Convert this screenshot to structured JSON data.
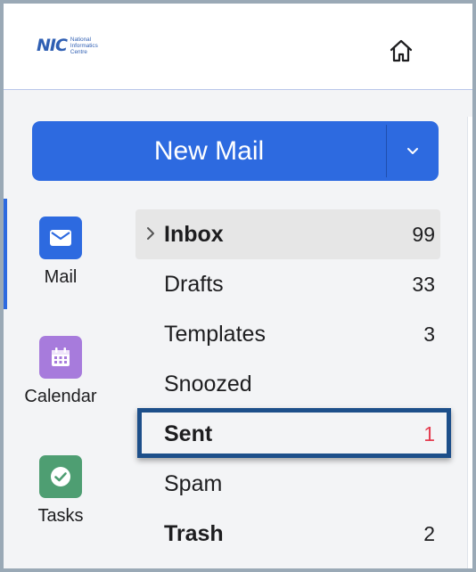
{
  "header": {
    "logo_mark": "NIC",
    "logo_line1": "National",
    "logo_line2": "Informatics",
    "logo_line3": "Centre",
    "home_icon": "home-icon"
  },
  "new_mail": {
    "label": "New Mail",
    "dropdown_icon": "chevron-down-icon",
    "color": "#2d6ae0"
  },
  "apps": [
    {
      "label": "Mail",
      "icon": "mail-icon",
      "color": "#2d6ae0"
    },
    {
      "label": "Calendar",
      "icon": "calendar-icon",
      "color": "#a77bdc"
    },
    {
      "label": "Tasks",
      "icon": "check-icon",
      "color": "#4e9e72"
    }
  ],
  "folders": [
    {
      "name": "Inbox",
      "count": "99",
      "bold": true,
      "active": true
    },
    {
      "name": "Drafts",
      "count": "33",
      "bold": false
    },
    {
      "name": "Templates",
      "count": "3",
      "bold": false
    },
    {
      "name": "Snoozed",
      "count": "",
      "bold": false
    },
    {
      "name": "Sent",
      "count": "1",
      "bold": true,
      "count_color": "#e43d50",
      "highlighted": true
    },
    {
      "name": "Spam",
      "count": "",
      "bold": false
    },
    {
      "name": "Trash",
      "count": "2",
      "bold": true
    }
  ]
}
